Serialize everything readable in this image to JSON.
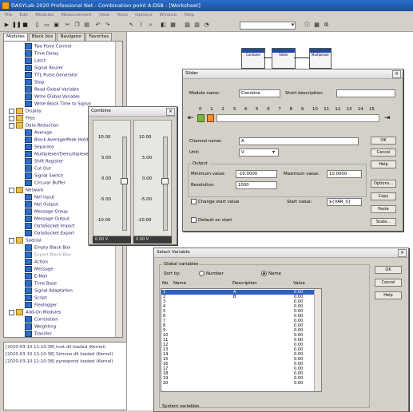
{
  "app": {
    "title": "DASYLab 2020 Professional Net - Combination point A.DSB - [Worksheet]"
  },
  "menu": [
    "File",
    "Edit",
    "Modules",
    "Measurement",
    "View",
    "Tools",
    "Options",
    "Window",
    "Help"
  ],
  "left_tabs": [
    "Modules",
    "Black box",
    "Navigator",
    "Favorites"
  ],
  "tree": {
    "items": [
      {
        "label": "Two Point Control",
        "kind": "module",
        "indent": 2
      },
      {
        "label": "Time Delay",
        "kind": "module",
        "indent": 2
      },
      {
        "label": "Latch",
        "kind": "module",
        "indent": 2
      },
      {
        "label": "Signal Router",
        "kind": "module",
        "indent": 2
      },
      {
        "label": "TTL Pulse Generator",
        "kind": "module",
        "indent": 2
      },
      {
        "label": "Stop",
        "kind": "module",
        "indent": 2
      },
      {
        "label": "Read Global Variable",
        "kind": "module",
        "indent": 2
      },
      {
        "label": "Write Global Variable",
        "kind": "module",
        "indent": 2
      },
      {
        "label": "Write Block Time to Signal",
        "kind": "module",
        "indent": 2
      },
      {
        "label": "Display",
        "kind": "folder",
        "indent": 1
      },
      {
        "label": "Files",
        "kind": "folder",
        "indent": 1
      },
      {
        "label": "Data Reduction",
        "kind": "folder",
        "indent": 1
      },
      {
        "label": "Average",
        "kind": "module",
        "indent": 2
      },
      {
        "label": "Block Average/Peak Hold",
        "kind": "module",
        "indent": 2
      },
      {
        "label": "Separate",
        "kind": "module",
        "indent": 2
      },
      {
        "label": "Multiplexer/Demultiplexer",
        "kind": "module",
        "indent": 2
      },
      {
        "label": "Shift Register",
        "kind": "module",
        "indent": 2
      },
      {
        "label": "Cut Out",
        "kind": "module",
        "indent": 2
      },
      {
        "label": "Signal Switch",
        "kind": "module",
        "indent": 2
      },
      {
        "label": "Circular Buffer",
        "kind": "module",
        "indent": 2
      },
      {
        "label": "Network",
        "kind": "folder",
        "indent": 1
      },
      {
        "label": "Net Input",
        "kind": "module",
        "indent": 2
      },
      {
        "label": "Net Output",
        "kind": "module",
        "indent": 2
      },
      {
        "label": "Message Group",
        "kind": "module",
        "indent": 2
      },
      {
        "label": "Message Output",
        "kind": "module",
        "indent": 2
      },
      {
        "label": "DataSocket Import",
        "kind": "module",
        "indent": 2
      },
      {
        "label": "DataSocket Export",
        "kind": "module",
        "indent": 2
      },
      {
        "label": "Special",
        "kind": "folder",
        "indent": 1
      },
      {
        "label": "Empty Black Box",
        "kind": "module",
        "indent": 2
      },
      {
        "label": "Export Black Box",
        "kind": "module-disabled",
        "indent": 2
      },
      {
        "label": "Action",
        "kind": "module",
        "indent": 2
      },
      {
        "label": "Message",
        "kind": "module",
        "indent": 2
      },
      {
        "label": "E-Mail",
        "kind": "module",
        "indent": 2
      },
      {
        "label": "Time Base",
        "kind": "module",
        "indent": 2
      },
      {
        "label": "Signal Adaptation",
        "kind": "module",
        "indent": 2
      },
      {
        "label": "Script",
        "kind": "module",
        "indent": 2
      },
      {
        "label": "Flexlogger",
        "kind": "module",
        "indent": 2
      },
      {
        "label": "Add-On Modules",
        "kind": "folder",
        "indent": 1
      },
      {
        "label": "Correlation",
        "kind": "module",
        "indent": 2
      },
      {
        "label": "Weighting",
        "kind": "module",
        "indent": 2
      },
      {
        "label": "Transfer",
        "kind": "module",
        "indent": 2
      }
    ]
  },
  "log": {
    "lines": [
      "[2020-03-10 11:10:38] tnet.dll loaded (Kernel)",
      "[2020-03-10 11:10:38] Simone.dll loaded (Kernel)",
      "[2020-03-10 11:10:38] pyrespond loaded (Kernel)"
    ]
  },
  "worksheet": {
    "blocks": [
      "Combine",
      "Slider",
      "Multiplexer"
    ]
  },
  "gauge": {
    "title": "Combine",
    "scale": [
      "10.00",
      "5.00",
      "0.00",
      "-5.00",
      "-10.00"
    ],
    "left_value": "0.00 V",
    "right_value": "0.00 V"
  },
  "slider_dlg": {
    "title": "Slider",
    "module_name_label": "Module name:",
    "module_name": "Combine",
    "short_desc_label": "Short description:",
    "short_desc": "",
    "channel_numbers": [
      "0",
      "1",
      "2",
      "3",
      "4",
      "5",
      "6",
      "7",
      "8",
      "9",
      "10",
      "11",
      "12",
      "13",
      "14",
      "15"
    ],
    "channel_name_label": "Channel name:",
    "channel_name": "A",
    "unit_label": "Unit:",
    "unit": "V",
    "output_label": "Output",
    "min_label": "Minimum value:",
    "min_value": "-10.0000",
    "max_label": "Maximum value:",
    "max_value": "10.0000",
    "resolution_label": "Resolution:",
    "resolution": "1000",
    "change_start_label": "Change start value",
    "start_value_label": "Start value:",
    "start_value": "${VAR_0}",
    "default_label": "Default on start",
    "buttons": [
      "OK",
      "Cancel",
      "Help",
      "Options...",
      "Copy",
      "Paste",
      "Scale..."
    ]
  },
  "select_var": {
    "title": "Select Variable",
    "group_label": "Global variables",
    "sort_by_label": "Sort by:",
    "sort_number": "Number",
    "sort_name": "Name",
    "columns": [
      "No.",
      "Name",
      "Description",
      "Value"
    ],
    "rows": [
      {
        "no": "1",
        "name": "",
        "desc": "A",
        "value": "0.00"
      },
      {
        "no": "2",
        "name": "",
        "desc": "B",
        "value": "0.00"
      },
      {
        "no": "3",
        "name": "",
        "desc": "",
        "value": "0.00"
      },
      {
        "no": "4",
        "name": "",
        "desc": "",
        "value": "0.00"
      },
      {
        "no": "5",
        "name": "",
        "desc": "",
        "value": "0.00"
      },
      {
        "no": "6",
        "name": "",
        "desc": "",
        "value": "0.00"
      },
      {
        "no": "7",
        "name": "",
        "desc": "",
        "value": "0.00"
      },
      {
        "no": "8",
        "name": "",
        "desc": "",
        "value": "0.00"
      },
      {
        "no": "9",
        "name": "",
        "desc": "",
        "value": "0.00"
      },
      {
        "no": "10",
        "name": "",
        "desc": "",
        "value": "0.00"
      },
      {
        "no": "11",
        "name": "",
        "desc": "",
        "value": "0.00"
      },
      {
        "no": "12",
        "name": "",
        "desc": "",
        "value": "0.00"
      },
      {
        "no": "13",
        "name": "",
        "desc": "",
        "value": "0.00"
      },
      {
        "no": "14",
        "name": "",
        "desc": "",
        "value": "0.00"
      },
      {
        "no": "15",
        "name": "",
        "desc": "",
        "value": "0.00"
      },
      {
        "no": "16",
        "name": "",
        "desc": "",
        "value": "0.00"
      },
      {
        "no": "17",
        "name": "",
        "desc": "",
        "value": "0.00"
      },
      {
        "no": "18",
        "name": "",
        "desc": "",
        "value": "0.00"
      },
      {
        "no": "19",
        "name": "",
        "desc": "",
        "value": "0.00"
      },
      {
        "no": "20",
        "name": "",
        "desc": "",
        "value": "0.00"
      }
    ],
    "system_label": "System variables",
    "buttons": [
      "OK",
      "Cancel",
      "Help"
    ]
  },
  "colors": {
    "title_blue": "#1c4f9c",
    "selection": "#2e5fc2"
  }
}
